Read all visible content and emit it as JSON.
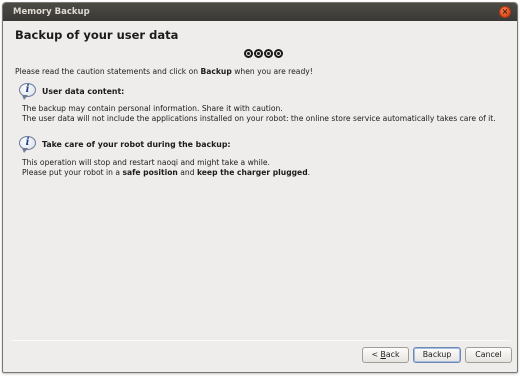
{
  "window": {
    "title": "Memory Backup",
    "close_glyph": "×"
  },
  "header": {
    "title": "Backup of your user data",
    "step_count": 4
  },
  "intro": {
    "prefix": "Please read the caution statements and click on ",
    "bold": "Backup",
    "suffix": " when you are ready!"
  },
  "sections": [
    {
      "icon": "info-icon",
      "title": "User data content:",
      "lines": [
        "The backup may contain personal information. Share it with caution.",
        "The user data will not include the applications installed on your robot: the online store service automatically takes care of it."
      ]
    },
    {
      "icon": "info-icon",
      "title": "Take care of your robot during the backup:",
      "line1": "This operation will stop and restart naoqi and might take a while.",
      "line2_prefix": "Please put your robot in a ",
      "line2_bold1": "safe position",
      "line2_mid": " and ",
      "line2_bold2": "keep the charger plugged",
      "line2_suffix": "."
    }
  ],
  "buttons": {
    "back_prefix": "< ",
    "back_mnemonic": "B",
    "back_rest": "ack",
    "backup": "Backup",
    "cancel": "Cancel"
  },
  "colors": {
    "titlebar": "#3c3b37",
    "close": "#e25a26",
    "background": "#efedeb"
  }
}
